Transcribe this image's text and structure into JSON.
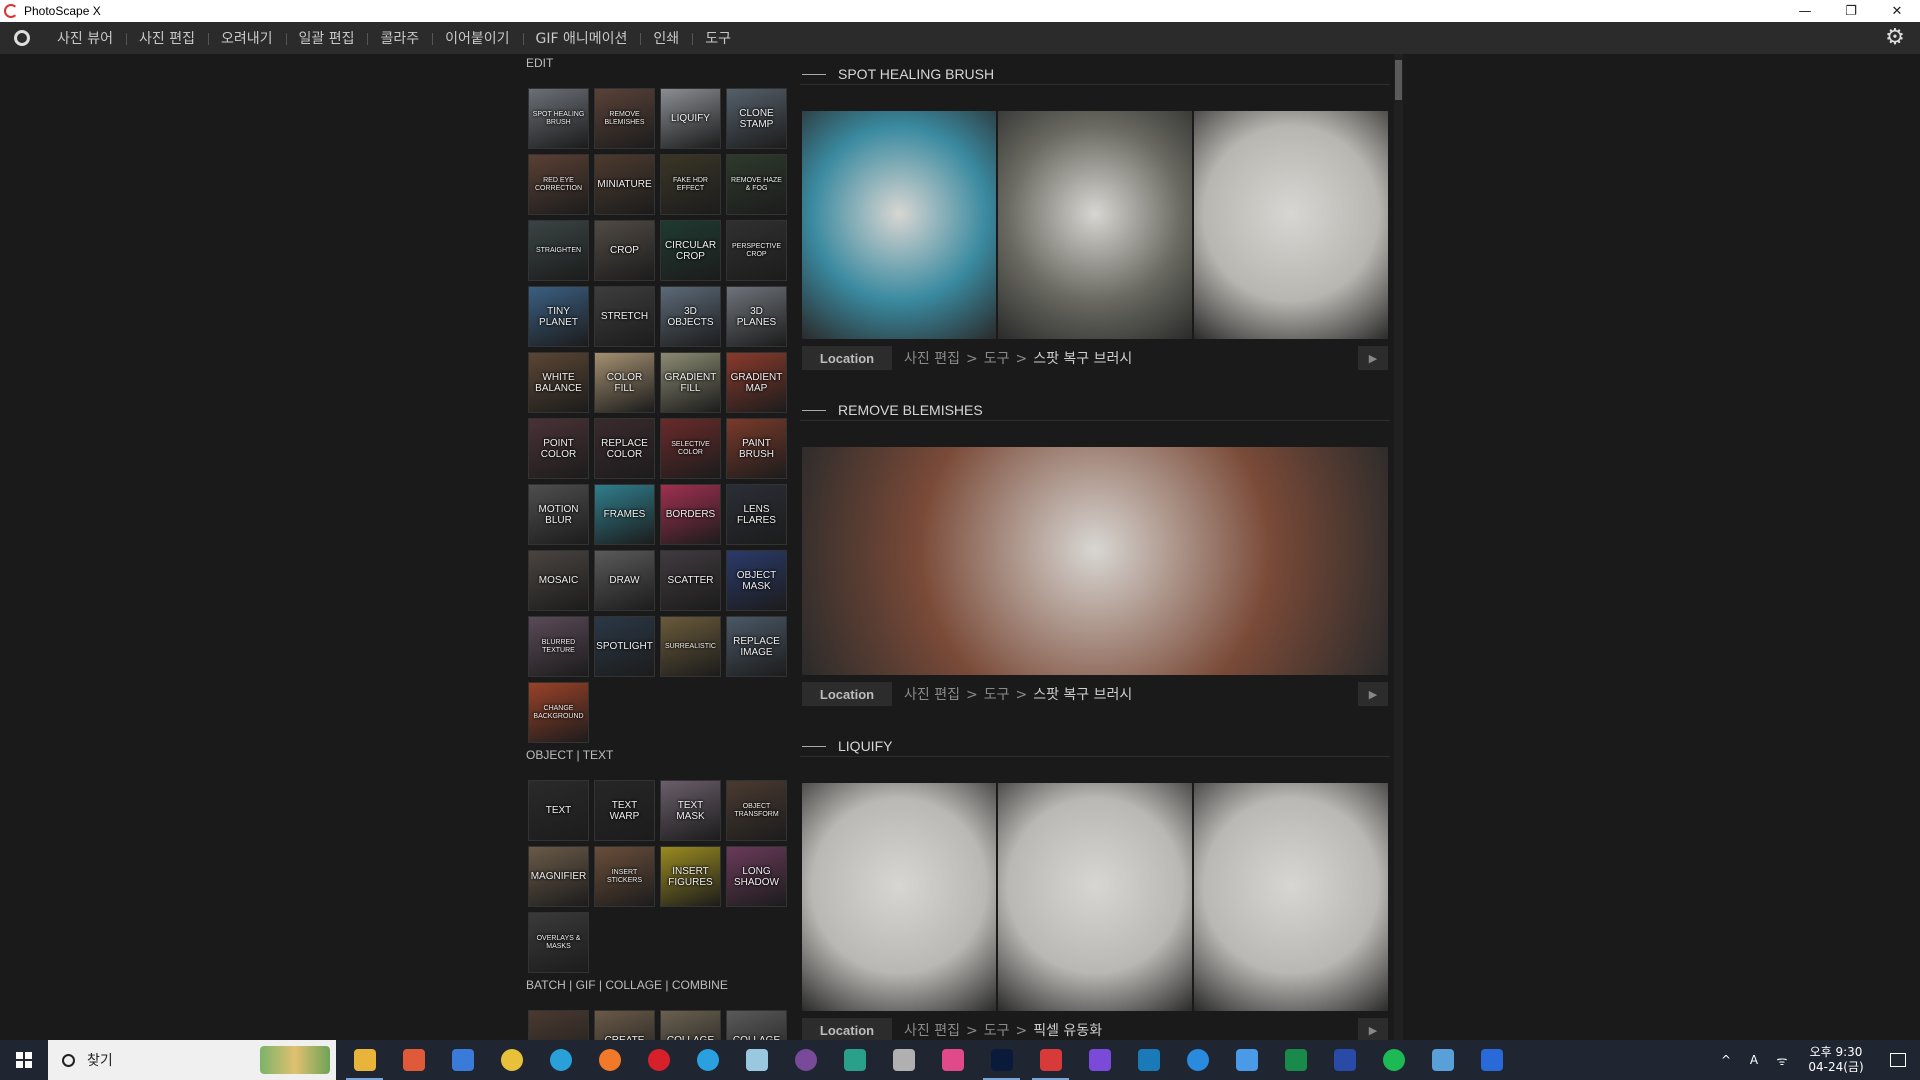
{
  "window": {
    "title": "PhotoScape X",
    "controls": {
      "minimize": "—",
      "restore": "❐",
      "close": "✕"
    }
  },
  "menu": {
    "items": [
      "사진 뷰어",
      "사진 편집",
      "오려내기",
      "일괄 편집",
      "콜라주",
      "이어붙이기",
      "GIF 애니메이션",
      "인쇄",
      "도구"
    ],
    "settings_icon": "gear-icon"
  },
  "sidebar": {
    "edit_title": "EDIT",
    "edit_tools": [
      {
        "label": "SPOT HEALING BRUSH",
        "bg": "#6b6f77"
      },
      {
        "label": "REMOVE BLEMISHES",
        "bg": "#5a4238"
      },
      {
        "label": "LIQUIFY",
        "bg": "#8a8d92"
      },
      {
        "label": "CLONE STAMP",
        "bg": "#55606a"
      },
      {
        "label": "RED EYE CORRECTION",
        "bg": "#5a4034"
      },
      {
        "label": "MINIATURE",
        "bg": "#4c3a2e"
      },
      {
        "label": "FAKE HDR EFFECT",
        "bg": "#3a3626"
      },
      {
        "label": "REMOVE HAZE & FOG",
        "bg": "#2e3a2c"
      },
      {
        "label": "STRAIGHTEN",
        "bg": "#3a4444"
      },
      {
        "label": "CROP",
        "bg": "#504a44"
      },
      {
        "label": "CIRCULAR CROP",
        "bg": "#1f3a30"
      },
      {
        "label": "PERSPECTIVE CROP",
        "bg": "#303030"
      },
      {
        "label": "TINY PLANET",
        "bg": "#3a5f82"
      },
      {
        "label": "STRETCH",
        "bg": "#3d3d3d"
      },
      {
        "label": "3D OBJECTS",
        "bg": "#5c6a78"
      },
      {
        "label": "3D PLANES",
        "bg": "#6e737a"
      },
      {
        "label": "WHITE BALANCE",
        "bg": "#5b4634"
      },
      {
        "label": "COLOR FILL",
        "bg": "#a39070"
      },
      {
        "label": "GRADIENT FILL",
        "bg": "#8a8a72"
      },
      {
        "label": "GRADIENT MAP",
        "bg": "#8a3a2c"
      },
      {
        "label": "POINT COLOR",
        "bg": "#4a3236"
      },
      {
        "label": "REPLACE COLOR",
        "bg": "#3a2a2e"
      },
      {
        "label": "SELECTIVE COLOR",
        "bg": "#6a2a2a"
      },
      {
        "label": "PAINT BRUSH",
        "bg": "#7a3a2a"
      },
      {
        "label": "MOTION BLUR",
        "bg": "#4e4e4e"
      },
      {
        "label": "FRAMES",
        "bg": "#2f7e8c"
      },
      {
        "label": "BORDERS",
        "bg": "#a03050"
      },
      {
        "label": "LENS FLARES",
        "bg": "#2a2e36"
      },
      {
        "label": "MOSAIC",
        "bg": "#4a4440"
      },
      {
        "label": "DRAW",
        "bg": "#5a5a5a"
      },
      {
        "label": "SCATTER",
        "bg": "#403a3e"
      },
      {
        "label": "OBJECT MASK",
        "bg": "#2a3a6a"
      },
      {
        "label": "BLURRED TEXTURE",
        "bg": "#5a4a58"
      },
      {
        "label": "SPOTLIGHT",
        "bg": "#2a3846"
      },
      {
        "label": "SURREALISTIC",
        "bg": "#6a5a3a"
      },
      {
        "label": "REPLACE IMAGE",
        "bg": "#4a5866"
      },
      {
        "label": "CHANGE BACKGROUND",
        "bg": "#9a4228"
      }
    ],
    "object_title": "OBJECT | TEXT",
    "object_tools": [
      {
        "label": "TEXT",
        "bg": "#2a2a2a"
      },
      {
        "label": "TEXT WARP",
        "bg": "#262626"
      },
      {
        "label": "TEXT MASK",
        "bg": "#6a5e6a"
      },
      {
        "label": "OBJECT TRANSFORM",
        "bg": "#4a3a30"
      },
      {
        "label": "MAGNIFIER",
        "bg": "#6a5a48"
      },
      {
        "label": "INSERT STICKERS",
        "bg": "#6a4e3a"
      },
      {
        "label": "INSERT FIGURES",
        "bg": "#9a8a20"
      },
      {
        "label": "LONG SHADOW",
        "bg": "#6a3a5a"
      },
      {
        "label": "OVERLAYS & MASKS",
        "bg": "#3a3a3a"
      }
    ],
    "batch_title": "BATCH | GIF | COLLAGE | COMBINE",
    "batch_tools": [
      {
        "label": "",
        "bg": "#4a3a30"
      },
      {
        "label": "CREATE",
        "bg": "#6a5a48"
      },
      {
        "label": "COLLAGE",
        "bg": "#6a6050"
      },
      {
        "label": "COLLAGE",
        "bg": "#5a5a5a"
      }
    ]
  },
  "content": {
    "sections": [
      {
        "title": "SPOT HEALING BRUSH",
        "images": [
          "#3a8aa0",
          "#6a6a62",
          "#b8b6b0"
        ],
        "location_label": "Location",
        "path": [
          "사진 편집",
          "도구"
        ],
        "current": "스팟 복구 브러시"
      },
      {
        "title": "REMOVE BLEMISHES",
        "images": [
          "#7a4a38"
        ],
        "location_label": "Location",
        "path": [
          "사진 편집",
          "도구"
        ],
        "current": "스팟 복구 브러시"
      },
      {
        "title": "LIQUIFY",
        "images": [
          "#bab8b4",
          "#bab8b4",
          "#bab8b4"
        ],
        "location_label": "Location",
        "path": [
          "사진 편집",
          "도구"
        ],
        "current": "픽셀 유동화"
      }
    ],
    "path_separator": ">",
    "play_icon": "▶"
  },
  "taskbar": {
    "search_placeholder": "찾기",
    "apps": [
      {
        "name": "file-explorer-icon",
        "color": "#e8b53a"
      },
      {
        "name": "paint-icon",
        "color": "#e05a3a"
      },
      {
        "name": "store-icon",
        "color": "#3a7ad8"
      },
      {
        "name": "chrome-icon",
        "color": "#e8c13a"
      },
      {
        "name": "edge-icon",
        "color": "#2aa0d8"
      },
      {
        "name": "firefox-icon",
        "color": "#f07a2a"
      },
      {
        "name": "opera-icon",
        "color": "#d8202a"
      },
      {
        "name": "telegram-icon",
        "color": "#2aa0e0"
      },
      {
        "name": "notepad-icon",
        "color": "#9ac8e0"
      },
      {
        "name": "tor-icon",
        "color": "#7a4a9a"
      },
      {
        "name": "s-app-icon",
        "color": "#2aa08a"
      },
      {
        "name": "paint3d-icon",
        "color": "#b0b0b0"
      },
      {
        "name": "photos-icon",
        "color": "#e04a8a"
      },
      {
        "name": "photoshop-icon",
        "color": "#0a1a3a"
      },
      {
        "name": "photoscape-icon",
        "color": "#d83a3a"
      },
      {
        "name": "office-icon",
        "color": "#7a4ad8"
      },
      {
        "name": "text-editor-icon",
        "color": "#1a7ab8"
      },
      {
        "name": "chat-icon",
        "color": "#2a8ae0"
      },
      {
        "name": "spark-icon",
        "color": "#4a9ae8"
      },
      {
        "name": "sheets-icon",
        "color": "#1a8a4a"
      },
      {
        "name": "writer-icon",
        "color": "#2a4aa8"
      },
      {
        "name": "spotify-icon",
        "color": "#1db954"
      },
      {
        "name": "remote-icon",
        "color": "#5aa0d8"
      },
      {
        "name": "r-app-icon",
        "color": "#2a6ad8"
      }
    ],
    "tray": {
      "chevron": "^",
      "ime": "A",
      "wifi": "ᯤ",
      "time": "오후 9:30",
      "date": "04-24(금)"
    }
  }
}
